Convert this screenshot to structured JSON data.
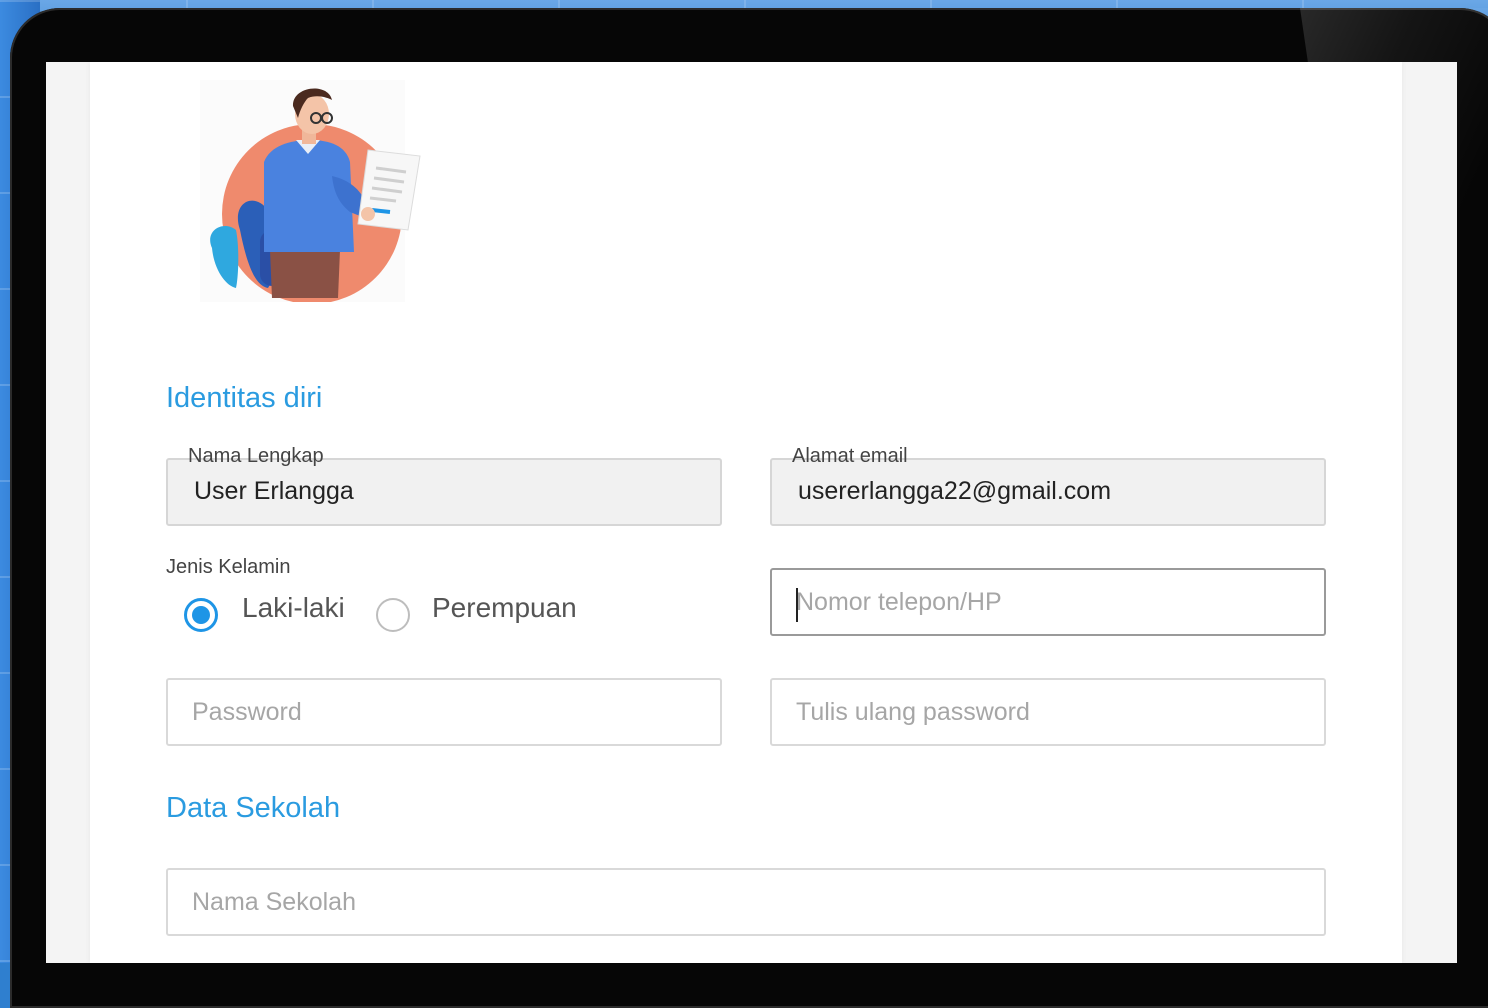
{
  "form": {
    "section_identity": "Identitas diri",
    "full_name": {
      "label": "Nama Lengkap",
      "value": "User Erlangga"
    },
    "email": {
      "label": "Alamat email",
      "value": "usererlangga22@gmail.com"
    },
    "gender": {
      "label": "Jenis Kelamin",
      "options": [
        "Laki-laki",
        "Perempuan"
      ],
      "selected": "Laki-laki"
    },
    "phone": {
      "placeholder": "Nomor telepon/HP"
    },
    "password": {
      "placeholder": "Password"
    },
    "password_repeat": {
      "placeholder": "Tulis ulang password"
    },
    "section_school": "Data Sekolah",
    "school_name": {
      "placeholder": "Nama Sekolah"
    }
  },
  "colors": {
    "accent": "#2a9be0",
    "radio_checked": "#1e95e6",
    "illustration_circle": "#ef8a6d",
    "illustration_shirt": "#4a82df"
  },
  "icons": {
    "illustration": "person-reading-document-illustration"
  }
}
